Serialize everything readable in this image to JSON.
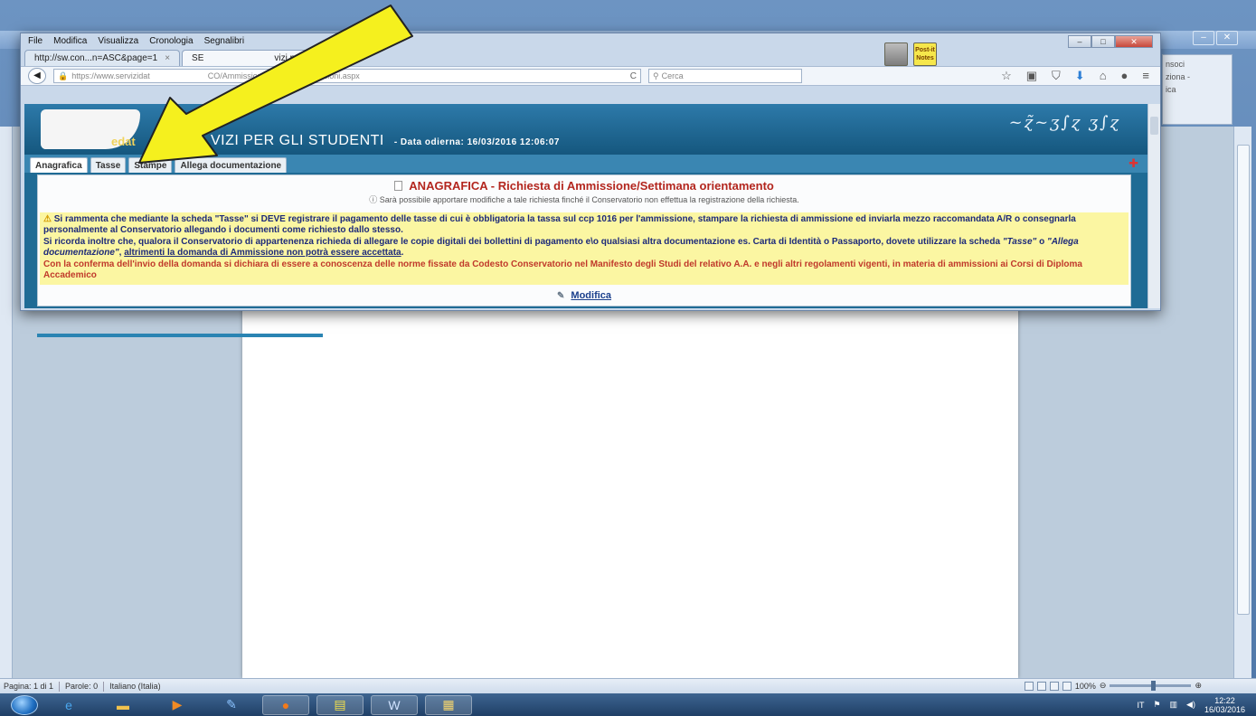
{
  "word": {
    "status_page": "Pagina: 1 di 1",
    "status_words": "Parole: 0",
    "status_lang": "Italiano (Italia)",
    "zoom": "100%",
    "ribbon_right": [
      "nsoci",
      "ziona -",
      "ica"
    ]
  },
  "taskbar": {
    "lang": "IT",
    "clock_time": "12:22",
    "clock_date": "16/03/2016"
  },
  "firefox": {
    "menu": [
      "File",
      "Modifica",
      "Visualizza",
      "Cronologia",
      "Segnalibri"
    ],
    "tabs": [
      {
        "label": "http://sw.con...n=ASC&page=1"
      },
      {
        "label": "SE",
        "suffix": "vizi per gli..."
      }
    ],
    "url": "https://www.servizidat",
    "url_tail": "CO/Ammissioni/GestioneAmmissioni.aspx",
    "search_placeholder": "Cerca",
    "addon_label": "Post-it Notes"
  },
  "app": {
    "logo_text": "edat",
    "title": "VIZI PER GLI STUDENTI",
    "date_label": "- Data odierna: 16/03/2016 12:06:07",
    "tabs": [
      "Anagrafica",
      "Tasse",
      "Stampe",
      "Allega documentazione"
    ],
    "heading": "ANAGRAFICA - Richiesta di Ammissione/Settimana orientamento",
    "subheading": "Sarà possibile apportare modifiche a tale richiesta finché il Conservatorio non effettua la registrazione della richiesta.",
    "notice_1": "Si rammenta che mediante la scheda \"Tasse\" si DEVE registrare il pagamento delle tasse di cui è obbligatoria la tassa sul ccp 1016 per l'ammissione, stampare la richiesta di ammissione ed inviarla mezzo raccomandata A/R o consegnarla personalmente al Conservatorio allegando i documenti come richiesto dallo stesso.",
    "notice_2a": "Si ricorda inoltre che, qualora il Conservatorio di appartenenza richieda di allegare le copie digitali dei bollettini di pagamento e\\o qualsiasi altra documentazione es. Carta di Identità o Passaporto, dovete utilizzare la scheda ",
    "notice_2_tasse": "\"Tasse\"",
    "notice_2_o": " o ",
    "notice_2_allega": "\"Allega documentazione\"",
    "notice_2_link": "altrimenti la domanda di Ammissione non potrà essere accettata",
    "notice_3": "Con la conferma dell'invio della domanda si dichiara di essere a conoscenza delle norme fissate da Codesto Conservatorio nel Manifesto degli Studi del relativo A.A. e negli altri regolamenti vigenti, in materia di ammissioni ai Corsi di Diploma Accademico",
    "edit_label": "Modifica"
  },
  "colors": {
    "arrow": "#f5f01e",
    "banner": "#1f6b95",
    "notice_bg": "#fbf6a2"
  }
}
